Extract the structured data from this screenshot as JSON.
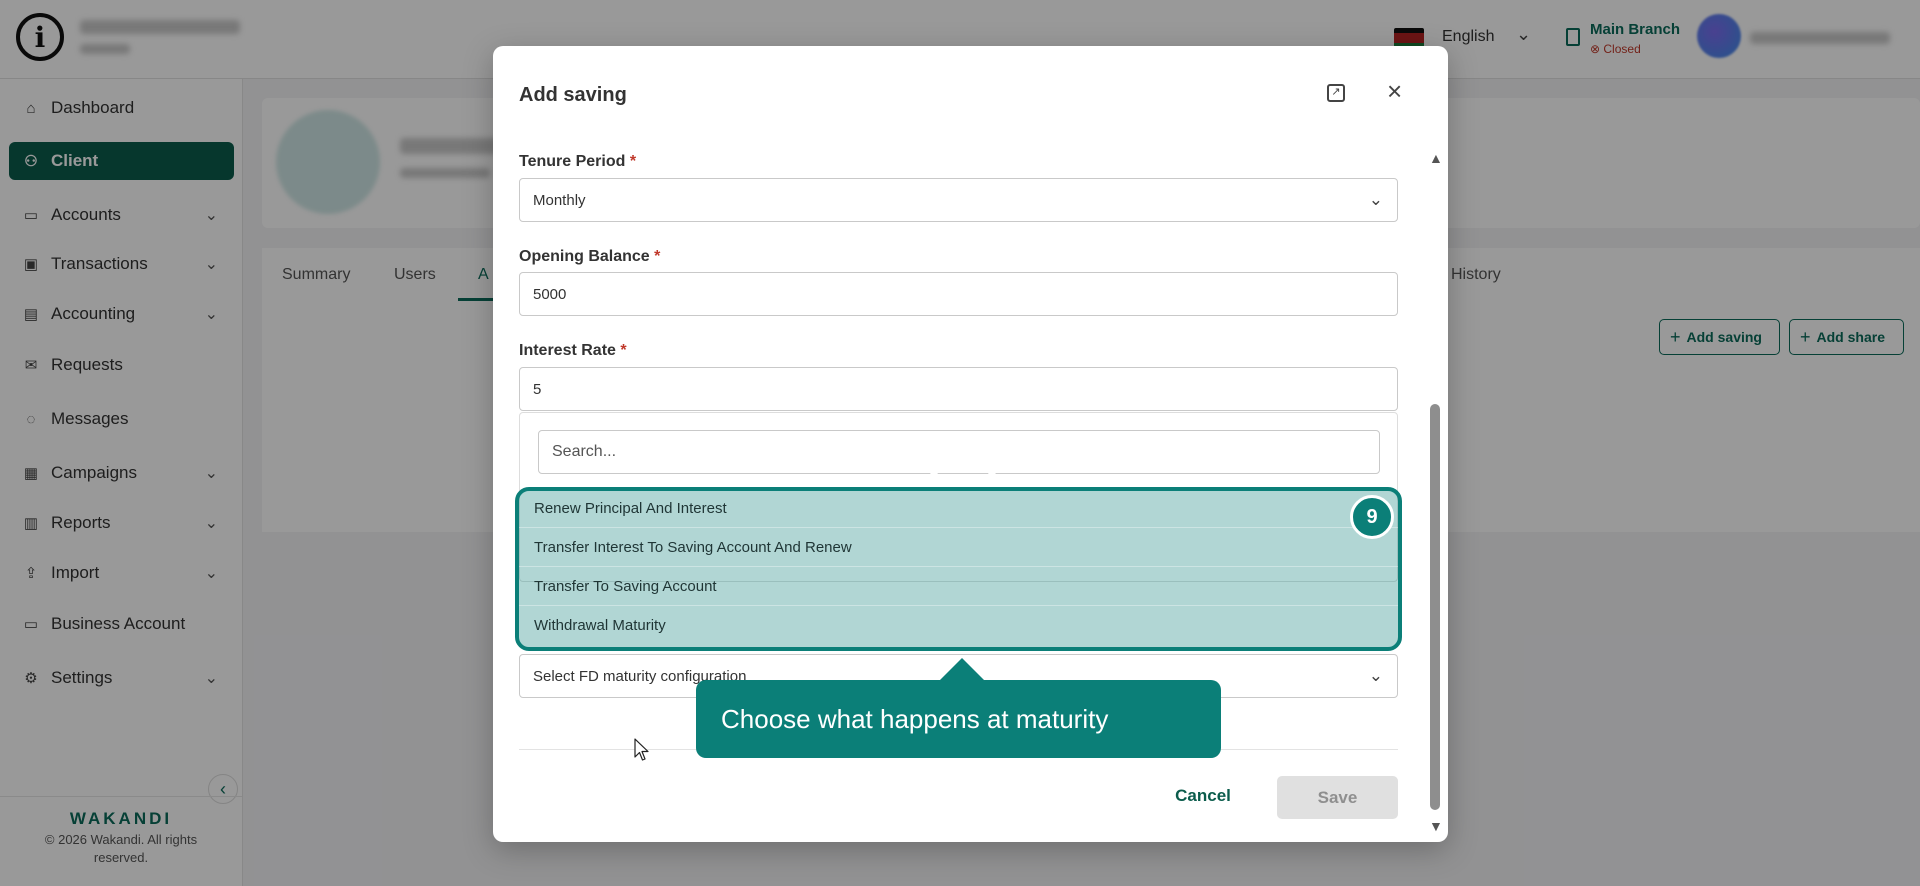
{
  "topbar": {
    "language": "English",
    "branch_name": "Main Branch",
    "branch_status": "Closed"
  },
  "sidebar": {
    "items": [
      {
        "label": "Dashboard",
        "icon": "home-icon"
      },
      {
        "label": "Client",
        "icon": "users-icon",
        "active": true
      },
      {
        "label": "Accounts",
        "icon": "briefcase-icon",
        "has_submenu": true
      },
      {
        "label": "Transactions",
        "icon": "money-icon",
        "has_submenu": true
      },
      {
        "label": "Accounting",
        "icon": "ledger-icon",
        "has_submenu": true
      },
      {
        "label": "Requests",
        "icon": "mail-icon"
      },
      {
        "label": "Messages",
        "icon": "chat-icon"
      },
      {
        "label": "Campaigns",
        "icon": "grid-icon",
        "has_submenu": true
      },
      {
        "label": "Reports",
        "icon": "chart-icon",
        "has_submenu": true
      },
      {
        "label": "Import",
        "icon": "upload-icon",
        "has_submenu": true
      },
      {
        "label": "Business Account",
        "icon": "briefcase-icon"
      },
      {
        "label": "Settings",
        "icon": "gear-icon",
        "has_submenu": true
      }
    ],
    "brand": "WAKANDI",
    "copyright_line1": "© 2026 Wakandi. All rights",
    "copyright_line2": "reserved."
  },
  "client_tabs": {
    "summary": "Summary",
    "users": "Users",
    "accounts_partial": "A",
    "history": "History"
  },
  "actions": {
    "add_saving": "Add saving",
    "add_share": "Add share"
  },
  "modal": {
    "title": "Add saving",
    "tenure_label": "Tenure Period",
    "tenure_value": "Monthly",
    "opening_balance_label": "Opening Balance",
    "opening_balance_value": "5000",
    "interest_rate_label": "Interest Rate",
    "interest_rate_value": "5",
    "required_marker": "*",
    "search_placeholder": "Search...",
    "maturity_options": [
      "Renew Principal And Interest",
      "Transfer Interest To Saving Account And Renew",
      "Transfer To Saving Account",
      "Withdrawal Maturity"
    ],
    "maturity_select_placeholder": "Select FD maturity configuration",
    "cancel_label": "Cancel",
    "save_label": "Save"
  },
  "tutorial": {
    "step_number": "9",
    "tooltip_text": "Choose what happens at maturity"
  },
  "colors": {
    "primary": "#0b5c4c",
    "highlight": "#0b7f78",
    "required": "#c0392b"
  }
}
